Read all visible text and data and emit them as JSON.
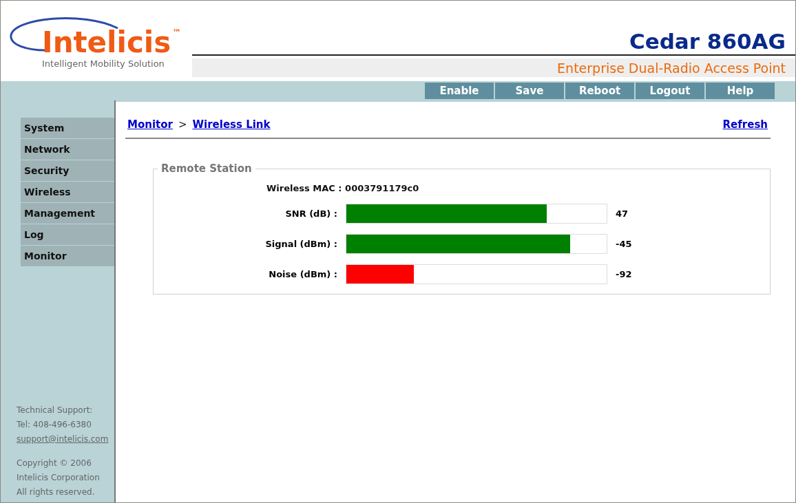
{
  "header": {
    "logo": "Intelicis",
    "logo_mark": "™",
    "tagline": "Intelligent Mobility Solution",
    "product": "Cedar 860AG",
    "subtitle": "Enterprise Dual-Radio Access Point"
  },
  "toolbar": [
    "Enable",
    "Save",
    "Reboot",
    "Logout",
    "Help"
  ],
  "sidebar": {
    "items": [
      "System",
      "Network",
      "Security",
      "Wireless",
      "Management",
      "Log",
      "Monitor"
    ],
    "support": {
      "title": "Technical Support:",
      "phone": "Tel: 408-496-6380",
      "email": "support@intelicis.com"
    },
    "copyright": [
      "Copyright © 2006",
      "Intelicis Corporation",
      "All rights reserved."
    ]
  },
  "breadcrumb": {
    "parent": "Monitor",
    "separator": ">",
    "current": "Wireless Link"
  },
  "refresh": "Refresh",
  "panel": {
    "title": "Remote Station",
    "mac_label": "Wireless MAC :",
    "mac": "0003791179c0",
    "meters": [
      {
        "name": "SNR (dB) :",
        "level": 0.77,
        "reading": "47",
        "color": "#008000"
      },
      {
        "name": "Signal (dBm) :",
        "level": 0.86,
        "reading": "-45",
        "color": "#008000"
      },
      {
        "name": "Noise (dBm) :",
        "level": 0.26,
        "reading": "-92",
        "color": "#ff0000"
      }
    ]
  }
}
